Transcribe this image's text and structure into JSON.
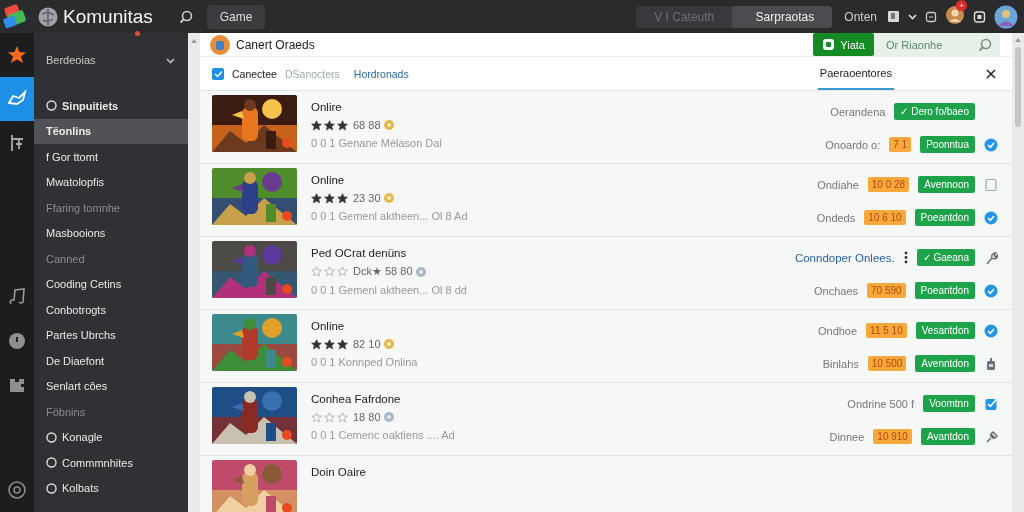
{
  "topbar": {
    "app_name": "Komunitas",
    "search_tab": "Game",
    "segments": [
      {
        "label": "V I Cateuth",
        "selected": false
      },
      {
        "label": "Sarpraotas",
        "selected": true
      }
    ],
    "user_label": "Onten",
    "notification_badge": "+"
  },
  "rail": [
    {
      "selected": false
    },
    {
      "selected": true
    },
    {
      "selected": false
    },
    {
      "selected": false
    },
    {
      "selected": false
    },
    {
      "selected": false
    },
    {
      "selected": false
    }
  ],
  "sidebar": {
    "header": "Berdeoias",
    "items": [
      {
        "label": "Sinpuitiets",
        "selected": false,
        "disabled": false,
        "kind": "icon"
      },
      {
        "label": "Tëonlins",
        "selected": true,
        "disabled": false,
        "kind": "plain"
      },
      {
        "label": "f Gor ttomt",
        "selected": false,
        "disabled": false,
        "kind": "plain"
      },
      {
        "label": "Mwatolopfis",
        "selected": false,
        "disabled": false,
        "kind": "plain"
      },
      {
        "label": "Ffaring tomnhe",
        "selected": false,
        "disabled": true,
        "kind": "plain"
      },
      {
        "label": "Masbooions",
        "selected": false,
        "disabled": false,
        "kind": "plain"
      },
      {
        "label": "Canned",
        "selected": false,
        "disabled": true,
        "kind": "plain"
      },
      {
        "label": "Cooding Cetins",
        "selected": false,
        "disabled": false,
        "kind": "plain"
      },
      {
        "label": "Conbotrogts",
        "selected": false,
        "disabled": false,
        "kind": "plain"
      },
      {
        "label": "Partes Ubrchs",
        "selected": false,
        "disabled": false,
        "kind": "plain"
      },
      {
        "label": "De Diaefont",
        "selected": false,
        "disabled": false,
        "kind": "plain"
      },
      {
        "label": "Senlart côes",
        "selected": false,
        "disabled": false,
        "kind": "plain"
      },
      {
        "label": "Föbnins",
        "selected": false,
        "disabled": true,
        "kind": "plain"
      },
      {
        "label": "Konagle",
        "selected": false,
        "disabled": false,
        "kind": "icon"
      },
      {
        "label": "Commmnhites",
        "selected": false,
        "disabled": false,
        "kind": "icon"
      },
      {
        "label": "Kolbats",
        "selected": false,
        "disabled": false,
        "kind": "icon"
      }
    ]
  },
  "panel": {
    "title": "Canert Oraeds",
    "action_button": "Yiata",
    "search": {
      "placeholder": "Or Riaonhe"
    },
    "filters": {
      "checked": true,
      "items": [
        {
          "label": "Canectee",
          "kind": "active"
        },
        {
          "label": "DSanocters",
          "kind": "muted"
        },
        {
          "label": "Hordronads",
          "kind": "link"
        }
      ]
    },
    "tabs": [
      {
        "label": "Paeraoentores",
        "selected": true
      }
    ]
  },
  "rows": [
    {
      "title": "Onlire",
      "stars": 3,
      "rating": "68 88",
      "subtitle": "0 0 1 Genane Mélason Dal",
      "lines": [
        {
          "status": "Oerandena",
          "kind": "text",
          "button": "✓ Dero fo/baeo"
        },
        {
          "status": "Onoardo o:",
          "kind": "text",
          "badge": "7 1",
          "button": "Poonntua"
        }
      ]
    },
    {
      "title": "Online",
      "stars": 3,
      "rating": "23 30",
      "subtitle": "0 0 1 Gemenl aktheen... Ol 8 Ad",
      "lines": [
        {
          "status": "Ondiahe",
          "kind": "text",
          "badge": "10 0 28",
          "button": "Avennoon"
        },
        {
          "status": "Ondeds",
          "kind": "text",
          "badge": "10 6 10",
          "button": "Poeantdon"
        }
      ]
    },
    {
      "title": "Ped OCrat denüns",
      "stars": 0,
      "rating": "Dck★ 58 80",
      "subtitle": "0 0 1 Gemenl aktheen... Ol 8 dd",
      "lines": [
        {
          "status": "Conndoper Onlees.",
          "kind": "link",
          "button": "✓ Gaeana"
        },
        {
          "status": "Onchaes",
          "kind": "text",
          "badge": "70 590",
          "button": "Poeantdon"
        }
      ]
    },
    {
      "title": "Online",
      "stars": 3,
      "rating": "82 10",
      "subtitle": "0 0 1 Konnped Onlina",
      "lines": [
        {
          "status": "Ondhoe",
          "kind": "text",
          "badge": "11 5 10",
          "button": "Vesantdon"
        },
        {
          "status": "Binlahs",
          "kind": "text",
          "badge": "10 500",
          "button": "Avenntdon"
        }
      ]
    },
    {
      "title": "Conhea Fafrdone",
      "stars": 0,
      "rating": "18 80",
      "subtitle": "0 0 1 Cemenc oaktiens .... Ad",
      "lines": [
        {
          "status": "Ondrine 500 f",
          "kind": "text",
          "button": "Voomtnn"
        },
        {
          "status": "Dinnee",
          "kind": "text",
          "badge": "10 910",
          "button": "Avantdon"
        }
      ]
    },
    {
      "title": "Doin Oaire",
      "lines": []
    }
  ]
}
